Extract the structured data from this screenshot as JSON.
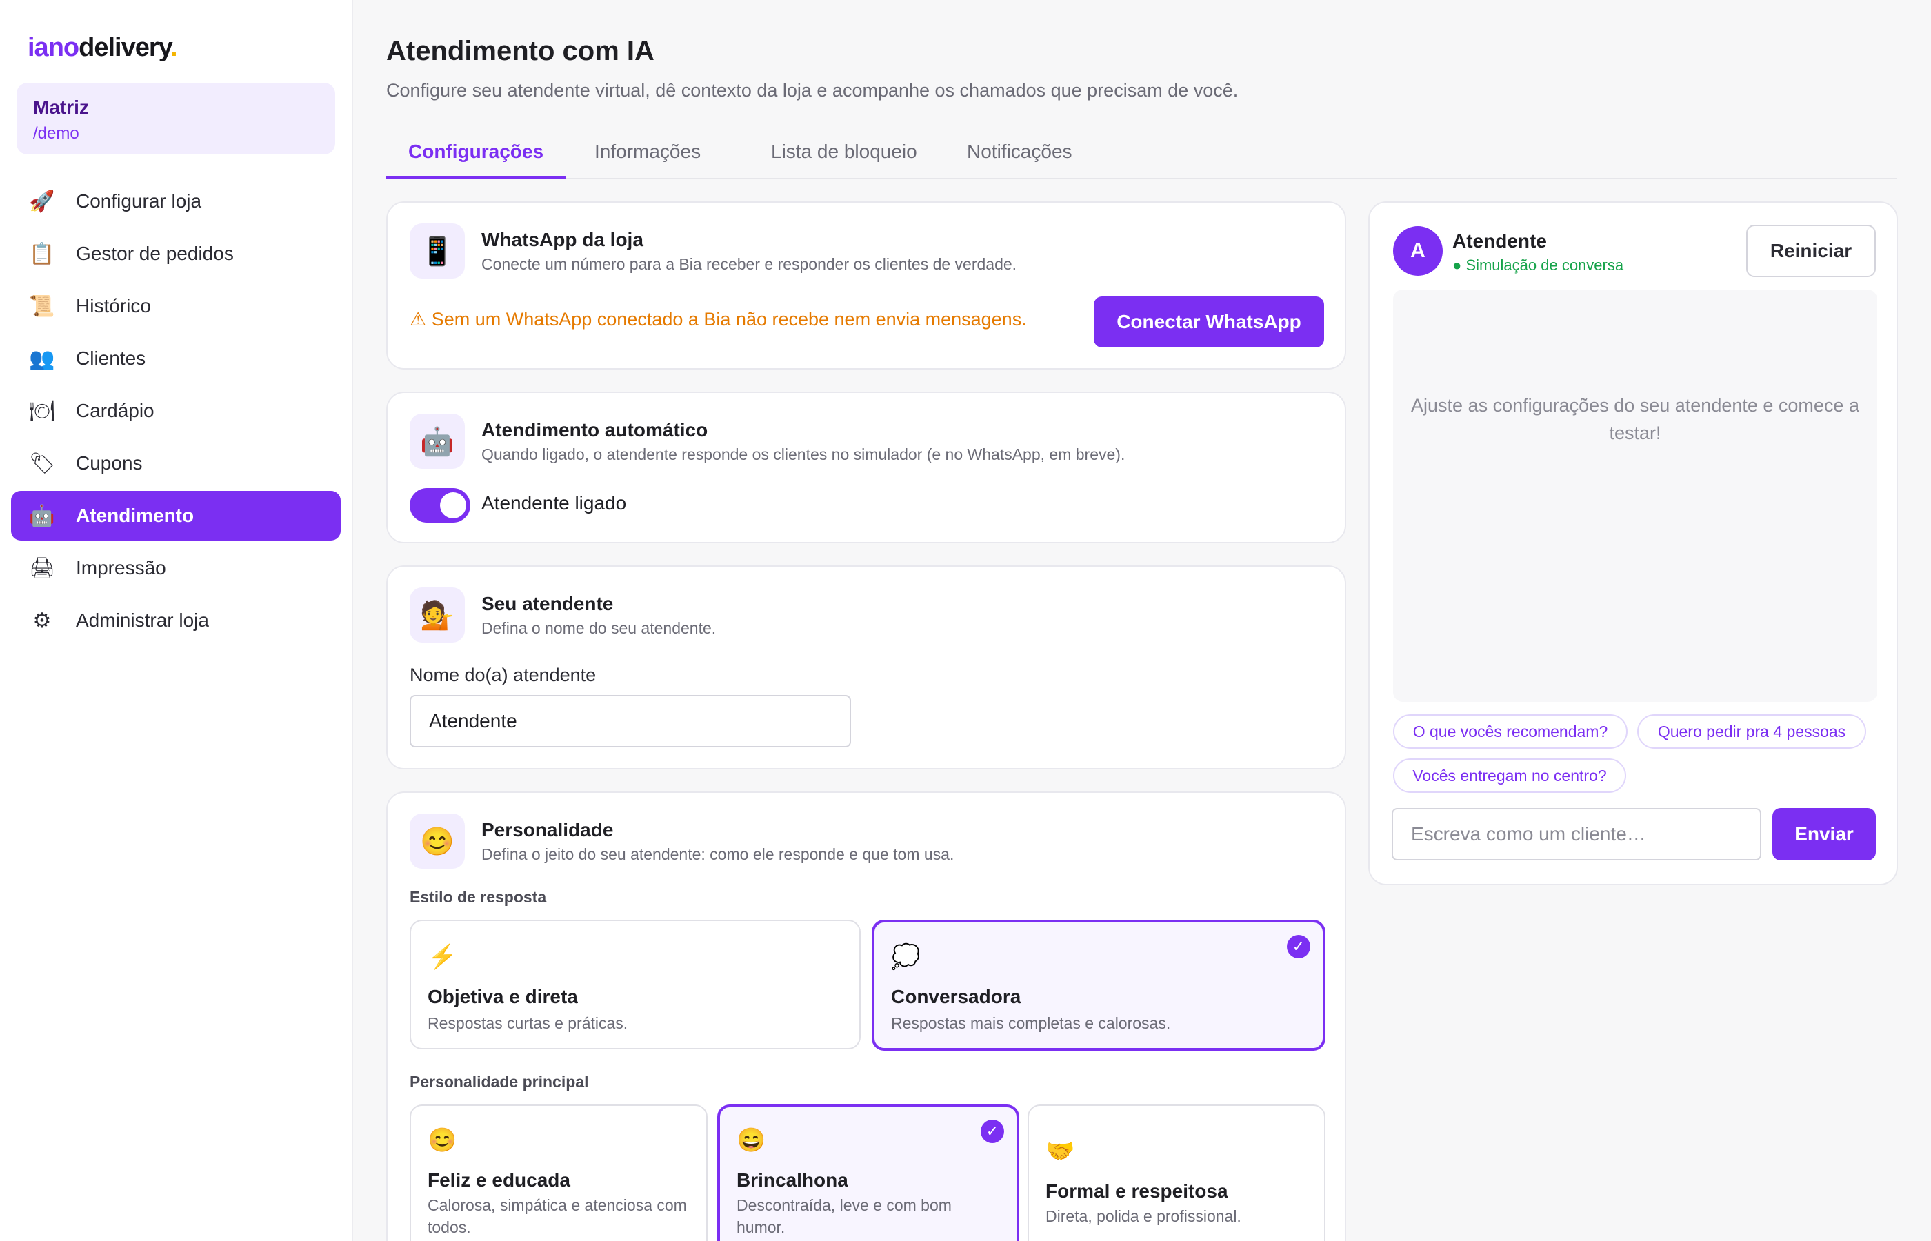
{
  "logo": {
    "part1": "iano",
    "part2": "delivery",
    "dot": "."
  },
  "store": {
    "name": "Matriz",
    "slug": "/demo"
  },
  "sidebar": {
    "items": [
      {
        "label": "Configurar loja",
        "icon": "rocket-icon",
        "glyph": "🚀"
      },
      {
        "label": "Gestor de pedidos",
        "icon": "clipboard-icon",
        "glyph": "📋"
      },
      {
        "label": "Histórico",
        "icon": "scroll-icon",
        "glyph": "📜"
      },
      {
        "label": "Clientes",
        "icon": "users-icon",
        "glyph": "👥"
      },
      {
        "label": "Cardápio",
        "icon": "plate-icon",
        "glyph": "🍽"
      },
      {
        "label": "Cupons",
        "icon": "tag-icon",
        "glyph": "🏷"
      },
      {
        "label": "Atendimento",
        "icon": "robot-icon",
        "glyph": "🤖",
        "active": true
      },
      {
        "label": "Impressão",
        "icon": "printer-icon",
        "glyph": "🖨"
      },
      {
        "label": "Administrar loja",
        "icon": "gear-icon",
        "glyph": "⚙"
      }
    ]
  },
  "page": {
    "title": "Atendimento com IA",
    "subtitle": "Configure seu atendente virtual, dê contexto da loja e acompanhe os chamados que precisam de você."
  },
  "tabs": [
    "Configurações",
    "Informações",
    "Lista de bloqueio",
    "Notificações"
  ],
  "whatsapp": {
    "icon_glyph": "📱",
    "title": "WhatsApp da loja",
    "desc": "Conecte um número para a Bia receber e responder os clientes de verdade.",
    "warning": "⚠ Sem um WhatsApp conectado a Bia não recebe nem envia mensagens.",
    "button": "Conectar WhatsApp"
  },
  "auto": {
    "icon_glyph": "🤖",
    "title": "Atendimento automático",
    "desc": "Quando ligado, o atendente responde os clientes no simulador (e no WhatsApp, em breve).",
    "toggle_label": "Atendente ligado",
    "toggle_on": true
  },
  "agent": {
    "icon_glyph": "💁",
    "title": "Seu atendente",
    "desc": "Defina o nome do seu atendente.",
    "field_label": "Nome do(a) atendente",
    "field_value": "Atendente"
  },
  "personality": {
    "icon_glyph": "😊",
    "title": "Personalidade",
    "desc": "Defina o jeito do seu atendente: como ele responde e que tom usa.",
    "style_label": "Estilo de resposta",
    "styles": [
      {
        "glyph": "⚡",
        "title": "Objetiva e direta",
        "desc": "Respostas curtas e práticas."
      },
      {
        "glyph": "💭",
        "title": "Conversadora",
        "desc": "Respostas mais completas e calorosas.",
        "selected": true
      }
    ],
    "main_label": "Personalidade principal",
    "mains": [
      {
        "glyph": "😊",
        "title": "Feliz e educada",
        "desc": "Calorosa, simpática e atenciosa com todos."
      },
      {
        "glyph": "😄",
        "title": "Brincalhona",
        "desc": "Descontraída, leve e com bom humor.",
        "selected": true
      },
      {
        "glyph": "🤝",
        "title": "Formal e respeitosa",
        "desc": "Direta, polida e profissional."
      }
    ]
  },
  "chat": {
    "avatar": "A",
    "name": "Atendente",
    "status": "● Simulação de conversa",
    "reset": "Reiniciar",
    "empty": "Ajuste as configurações do seu atendente e comece a testar!",
    "chips": [
      "O que vocês recomendam?",
      "Quero pedir pra 4 pessoas",
      "Vocês entregam no centro?"
    ],
    "placeholder": "Escreva como um cliente…",
    "send": "Enviar"
  },
  "colors": {
    "accent": "#7b2ff2",
    "warning": "#e57a00",
    "online": "#16a34a"
  }
}
